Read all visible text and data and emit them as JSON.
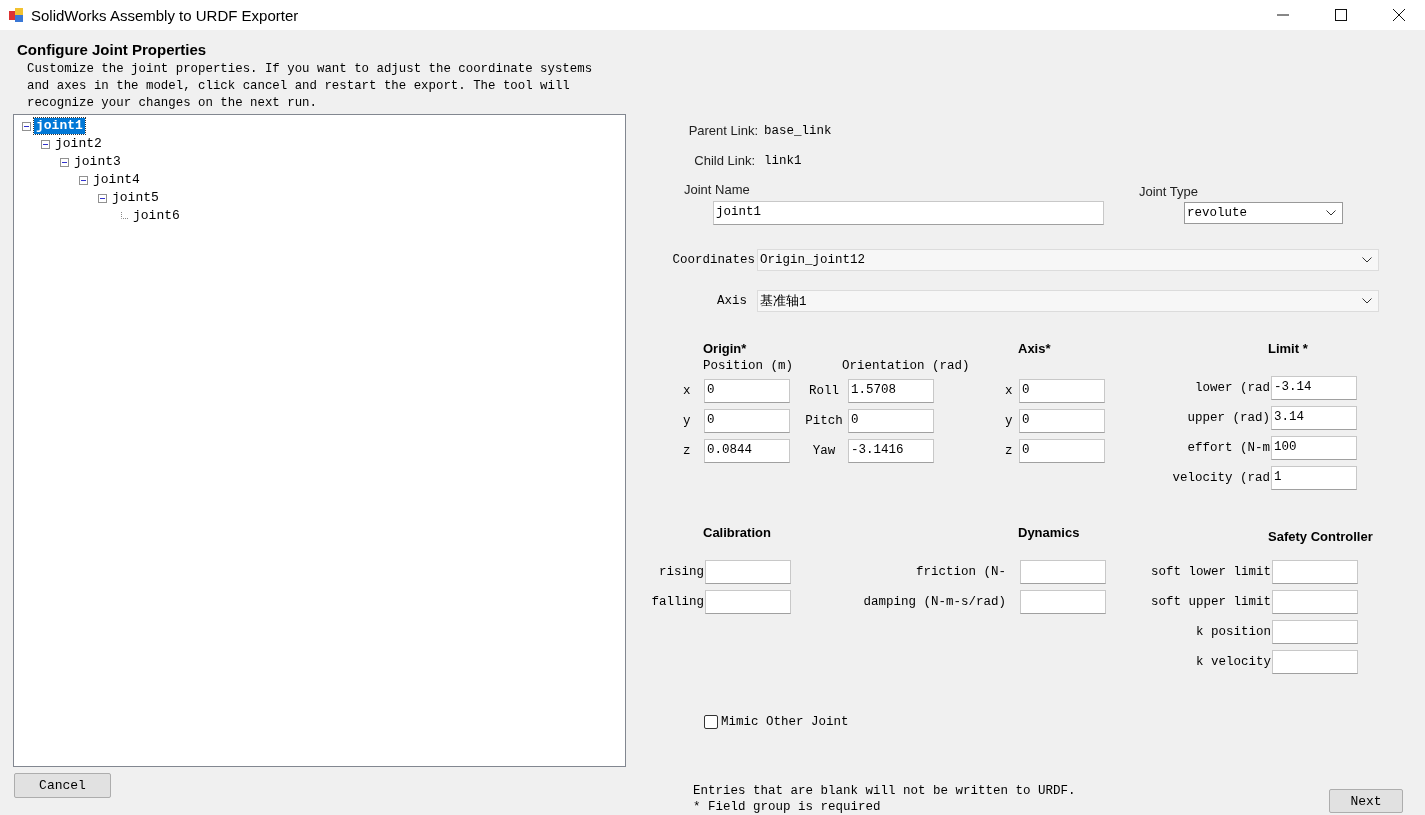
{
  "window": {
    "title": "SolidWorks Assembly to URDF Exporter"
  },
  "heading": "Configure Joint Properties",
  "description": "Customize the joint properties. If you want to adjust the coordinate systems and axes in the model, click cancel and restart the export. The tool will recognize your changes on the next run.",
  "joint_tree": [
    {
      "label": "joint1",
      "selected": true,
      "expanded": true,
      "children": [
        {
          "label": "joint2",
          "selected": false,
          "expanded": true,
          "children": [
            {
              "label": "joint3",
              "selected": false,
              "expanded": true,
              "children": [
                {
                  "label": "joint4",
                  "selected": false,
                  "expanded": true,
                  "children": [
                    {
                      "label": "joint5",
                      "selected": false,
                      "expanded": true,
                      "children": [
                        {
                          "label": "joint6",
                          "selected": false
                        }
                      ]
                    }
                  ]
                }
              ]
            }
          ]
        }
      ]
    }
  ],
  "cancel_button": "Cancel",
  "parent_link": {
    "label": "Parent Link:",
    "value": "base_link"
  },
  "child_link": {
    "label": "Child Link:",
    "value": "link1"
  },
  "joint_name": {
    "label": "Joint Name",
    "value": "joint1"
  },
  "joint_type": {
    "label": "Joint Type",
    "value": "revolute"
  },
  "coordinates": {
    "label": "Coordinates",
    "value": "Origin_joint12"
  },
  "axis_select": {
    "label": "Axis",
    "value": "基准轴1"
  },
  "origin": {
    "title": "Origin*",
    "position_label": "Position (m)",
    "orientation_label": "Orientation (rad)",
    "position": [
      {
        "label": "x",
        "value": "0"
      },
      {
        "label": "y",
        "value": "0"
      },
      {
        "label": "z",
        "value": "0.0844"
      }
    ],
    "orientation": [
      {
        "label": "Roll",
        "value": "1.5708"
      },
      {
        "label": "Pitch",
        "value": "0"
      },
      {
        "label": "Yaw",
        "value": "-3.1416"
      }
    ]
  },
  "axis": {
    "title": "Axis*",
    "fields": [
      {
        "label": "x",
        "value": "0"
      },
      {
        "label": "y",
        "value": "0"
      },
      {
        "label": "z",
        "value": "0"
      }
    ]
  },
  "limit": {
    "title": "Limit *",
    "fields": [
      {
        "label": "lower (rad",
        "value": "-3.14"
      },
      {
        "label": "upper (rad)",
        "value": "3.14"
      },
      {
        "label": "effort (N-m",
        "value": "100"
      },
      {
        "label": "velocity (rad",
        "value": "1"
      }
    ]
  },
  "calibration": {
    "title": "Calibration",
    "fields": [
      {
        "label": "rising"
      },
      {
        "label": "falling"
      }
    ]
  },
  "dynamics": {
    "title": "Dynamics",
    "fields": [
      {
        "label": "friction (N-"
      },
      {
        "label": "damping (N-m-s/rad)"
      }
    ]
  },
  "safety_controller": {
    "title": "Safety Controller",
    "fields": [
      {
        "label": "soft lower limit"
      },
      {
        "label": "soft upper limit"
      },
      {
        "label": "k position"
      },
      {
        "label": "k velocity"
      }
    ]
  },
  "mimic": {
    "label": "Mimic Other Joint",
    "checked": false
  },
  "notes": [
    "Entries that are blank will not be written to URDF.",
    "* Field group is required"
  ],
  "next_button": "Next"
}
